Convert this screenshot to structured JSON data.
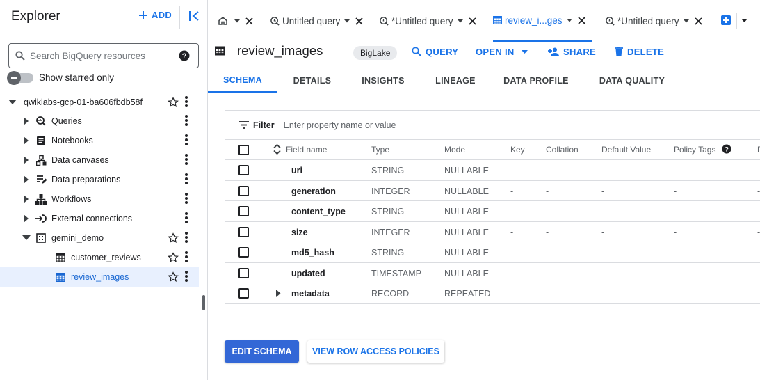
{
  "explorer": {
    "title": "Explorer",
    "add_label": "ADD",
    "search_placeholder": "Search BigQuery resources",
    "starred_label": "Show starred only",
    "tree": [
      {
        "label": "qwiklabs-gcp-01-ba606fbdb58f",
        "icon": "caret-down",
        "type": "project"
      },
      {
        "label": "Queries",
        "icon": "query-icon"
      },
      {
        "label": "Notebooks",
        "icon": "notebook-icon"
      },
      {
        "label": "Data canvases",
        "icon": "canvas-icon"
      },
      {
        "label": "Data preparations",
        "icon": "data-prep-icon"
      },
      {
        "label": "Workflows",
        "icon": "workflow-icon"
      },
      {
        "label": "External connections",
        "icon": "connection-icon"
      },
      {
        "label": "gemini_demo",
        "icon": "dataset-icon"
      },
      {
        "label": "customer_reviews",
        "icon": "table-icon"
      },
      {
        "label": "review_images",
        "icon": "table-icon",
        "selected": true
      }
    ]
  },
  "tabs": [
    {
      "label": "",
      "icon": "home-icon"
    },
    {
      "label": "Untitled query",
      "icon": "query-icon"
    },
    {
      "label": "*Untitled query",
      "icon": "query-icon"
    },
    {
      "label": "review_i...ges",
      "icon": "table-icon",
      "active": true
    },
    {
      "label": "*Untitled query",
      "icon": "query-icon"
    }
  ],
  "header": {
    "title": "review_images",
    "badge": "BigLake",
    "actions": {
      "query": "QUERY",
      "open_in": "OPEN IN",
      "share": "SHARE",
      "delete": "DELETE"
    }
  },
  "subtabs": [
    "SCHEMA",
    "DETAILS",
    "INSIGHTS",
    "LINEAGE",
    "DATA PROFILE",
    "DATA QUALITY"
  ],
  "schema": {
    "filter_label": "Filter",
    "filter_placeholder": "Enter property name or value",
    "columns": [
      "Field name",
      "Type",
      "Mode",
      "Key",
      "Collation",
      "Default Value",
      "Policy Tags",
      "D"
    ],
    "rows": [
      {
        "name": "uri",
        "type": "STRING",
        "mode": "NULLABLE",
        "key": "-",
        "collation": "-",
        "default": "-",
        "policy": "-",
        "desc": "-"
      },
      {
        "name": "generation",
        "type": "INTEGER",
        "mode": "NULLABLE",
        "key": "-",
        "collation": "-",
        "default": "-",
        "policy": "-",
        "desc": "-"
      },
      {
        "name": "content_type",
        "type": "STRING",
        "mode": "NULLABLE",
        "key": "-",
        "collation": "-",
        "default": "-",
        "policy": "-",
        "desc": "-"
      },
      {
        "name": "size",
        "type": "INTEGER",
        "mode": "NULLABLE",
        "key": "-",
        "collation": "-",
        "default": "-",
        "policy": "-",
        "desc": "-"
      },
      {
        "name": "md5_hash",
        "type": "STRING",
        "mode": "NULLABLE",
        "key": "-",
        "collation": "-",
        "default": "-",
        "policy": "-",
        "desc": "-"
      },
      {
        "name": "updated",
        "type": "TIMESTAMP",
        "mode": "NULLABLE",
        "key": "-",
        "collation": "-",
        "default": "-",
        "policy": "-",
        "desc": "-"
      },
      {
        "name": "metadata",
        "type": "RECORD",
        "mode": "REPEATED",
        "key": "-",
        "collation": "-",
        "default": "-",
        "policy": "-",
        "desc": "-",
        "expandable": true
      }
    ]
  },
  "buttons": {
    "edit_schema": "EDIT SCHEMA",
    "view_row_access": "VIEW ROW ACCESS POLICIES"
  },
  "colors": {
    "accent": "#1a73e8",
    "primary_button": "#3367d6",
    "selected_bg": "#e8f0fe",
    "text": "#202124",
    "muted": "#5f6368"
  }
}
